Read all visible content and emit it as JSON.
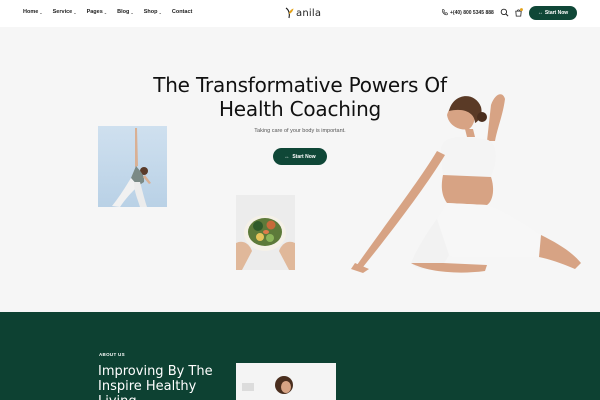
{
  "header": {
    "nav": [
      {
        "label": "Home",
        "caret": true
      },
      {
        "label": "Service",
        "caret": true
      },
      {
        "label": "Pages",
        "caret": true
      },
      {
        "label": "Blog",
        "caret": true
      },
      {
        "label": "Shop",
        "caret": true
      },
      {
        "label": "Contact",
        "caret": false
      }
    ],
    "logo_text": "anila",
    "phone": "+(40) 800 5345 888",
    "cta_label": "Start Now",
    "cart_count": "0",
    "icons": {
      "phone": "phone-icon",
      "search": "search-icon",
      "cart": "cart-icon",
      "arrow": "arrow-icon"
    }
  },
  "hero": {
    "title": "The Transformative Powers Of Health Coaching",
    "subtitle": "Taking care of your body is important.",
    "cta_label": "Start Now"
  },
  "about": {
    "kicker": "ABOUT US",
    "title": "Improving By The Inspire Healthy Living"
  },
  "colors": {
    "brand": "#0f4737",
    "about_bg": "#0d4132",
    "hero_bg": "#f6f6f6",
    "accent_logo": "#e3a21a"
  }
}
